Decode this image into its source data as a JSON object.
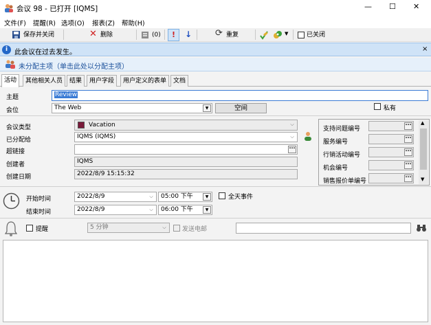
{
  "window": {
    "title": "会议 98 - 已打开 [IQMS]",
    "minimize": "—",
    "maximize": "☐",
    "close": "✕"
  },
  "menu": [
    "文件(F)",
    "提醒(R)",
    "选项(O)",
    "报表(Z)",
    "帮助(H)"
  ],
  "toolbar": {
    "save_close": "保存并关闭",
    "delete": "删除",
    "attach_count": "(0)",
    "recurrence": "重复",
    "closed_label": "已关闭"
  },
  "info_bar": {
    "message": "此会议在过去发生。",
    "close": "×"
  },
  "assign_bar": {
    "message": "未分配主项（单击此处以分配主项）"
  },
  "tabs": [
    "活动",
    "其他相关人员",
    "结果",
    "用户字段",
    "用户定义的表单",
    "文档"
  ],
  "form": {
    "subject_label": "主题",
    "subject_value": "Review",
    "location_label": "会位",
    "location_value": "The Web",
    "room_button": "空间",
    "private_label": "私有",
    "meeting_type_label": "会议类型",
    "meeting_type_value": "Vacation",
    "meeting_type_color": "#7a1a3a",
    "assigned_label": "已分配给",
    "assigned_value": "IQMS (IQMS)",
    "hyperlink_label": "超链接",
    "hyperlink_value": "",
    "creator_label": "创建者",
    "creator_value": "IQMS",
    "created_date_label": "创建日期",
    "created_date_value": "2022/8/9 15:15:32"
  },
  "refs": [
    "支持问题编号",
    "服务编号",
    "行销活动编号",
    "机会编号",
    "销售报价单编号"
  ],
  "time": {
    "start_label": "开始时间",
    "start_date": "2022/8/9",
    "start_time": "05:00 下午",
    "end_label": "结束时间",
    "end_date": "2022/8/9",
    "end_time": "06:00 下午",
    "all_day_label": "全天事件"
  },
  "reminder": {
    "label": "提醒",
    "minutes": "5 分钟",
    "email_label": "发送电邮",
    "email_value": ""
  },
  "notes": ""
}
